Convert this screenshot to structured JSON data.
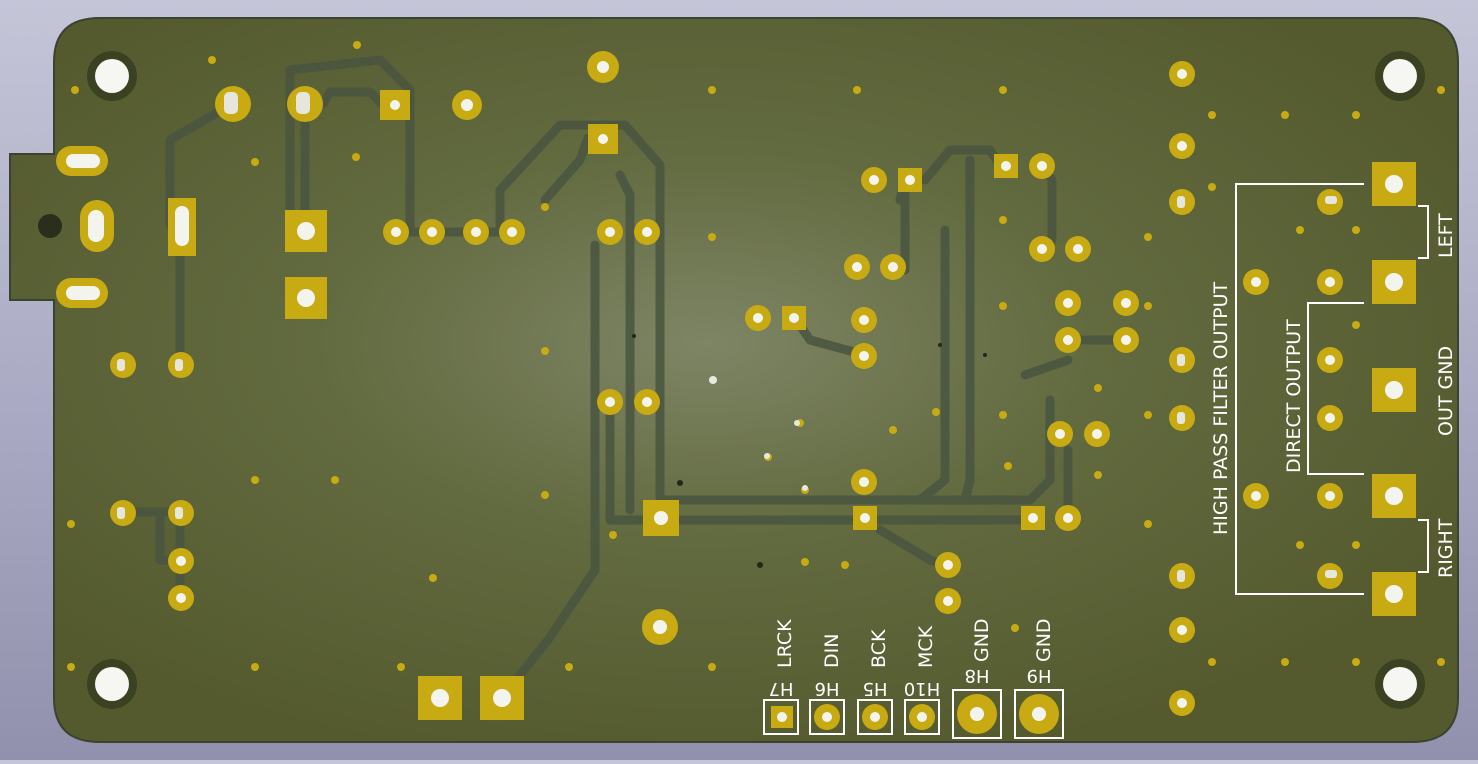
{
  "board": {
    "colors": {
      "substrate": "#5a6038",
      "copper_trace": "#4f5a40",
      "pad": "#c8aa12",
      "pad_hole": "#f4f4ee",
      "silkscreen": "#ffffff",
      "background": "#b8b8cc"
    },
    "connector_labels": {
      "lrck": "LRCK",
      "din": "DIN",
      "bck": "BCK",
      "mck": "MCK",
      "gnd_1": "GND",
      "gnd_2": "GND"
    },
    "header_refs": {
      "h7": "H7",
      "h6": "H6",
      "h5": "H5",
      "h10": "H10",
      "h8": "H8",
      "h9": "H9"
    },
    "output_labels": {
      "high_pass": "HIGH PASS FILTER OUTPUT",
      "direct": "DIRECT OUTPUT",
      "left": "LEFT",
      "out_gnd": "OUT GND",
      "right": "RIGHT"
    }
  }
}
